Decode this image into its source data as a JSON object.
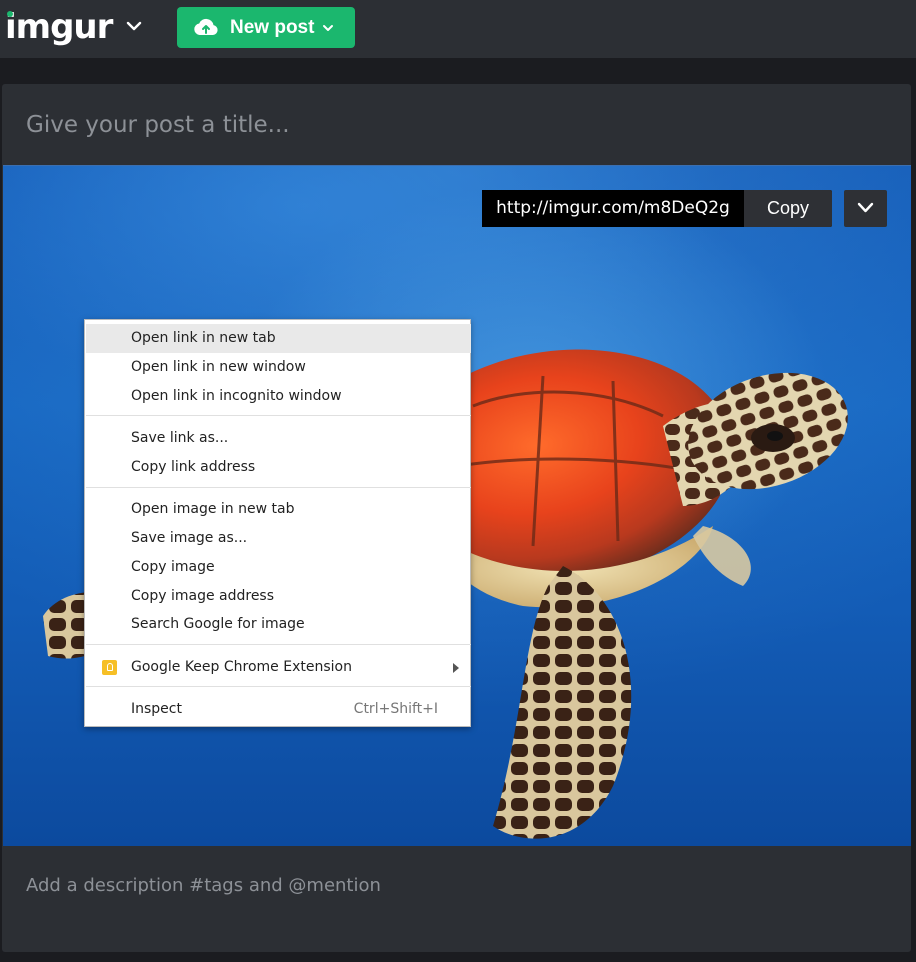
{
  "header": {
    "logo_text": "imgur",
    "new_post_label": "New post"
  },
  "post": {
    "title_placeholder": "Give your post a title...",
    "description_placeholder": "Add a description #tags and @mention",
    "image_alt": "Sea turtle swimming in blue water",
    "share_url": "http://imgur.com/m8DeQ2g",
    "copy_label": "Copy"
  },
  "context_menu": {
    "groups": [
      [
        "Open link in new tab",
        "Open link in new window",
        "Open link in incognito window"
      ],
      [
        "Save link as...",
        "Copy link address"
      ],
      [
        "Open image in new tab",
        "Save image as...",
        "Copy image",
        "Copy image address",
        "Search Google for image"
      ],
      [
        "Google Keep Chrome Extension"
      ],
      [
        "Inspect"
      ]
    ],
    "items": {
      "open_link_new_tab": "Open link in new tab",
      "open_link_new_window": "Open link in new window",
      "open_link_incognito": "Open link in incognito window",
      "save_link_as": "Save link as...",
      "copy_link_address": "Copy link address",
      "open_image_new_tab": "Open image in new tab",
      "save_image_as": "Save image as...",
      "copy_image": "Copy image",
      "copy_image_address": "Copy image address",
      "search_google_image": "Search Google for image",
      "google_keep": "Google Keep Chrome Extension",
      "inspect": "Inspect",
      "inspect_shortcut": "Ctrl+Shift+I"
    },
    "highlighted_item": "Open link in new tab"
  },
  "colors": {
    "brand_green": "#1bb76e",
    "page_bg": "#1b1c20",
    "card_bg": "#2c2f34",
    "keep_yellow": "#f6bf26"
  }
}
